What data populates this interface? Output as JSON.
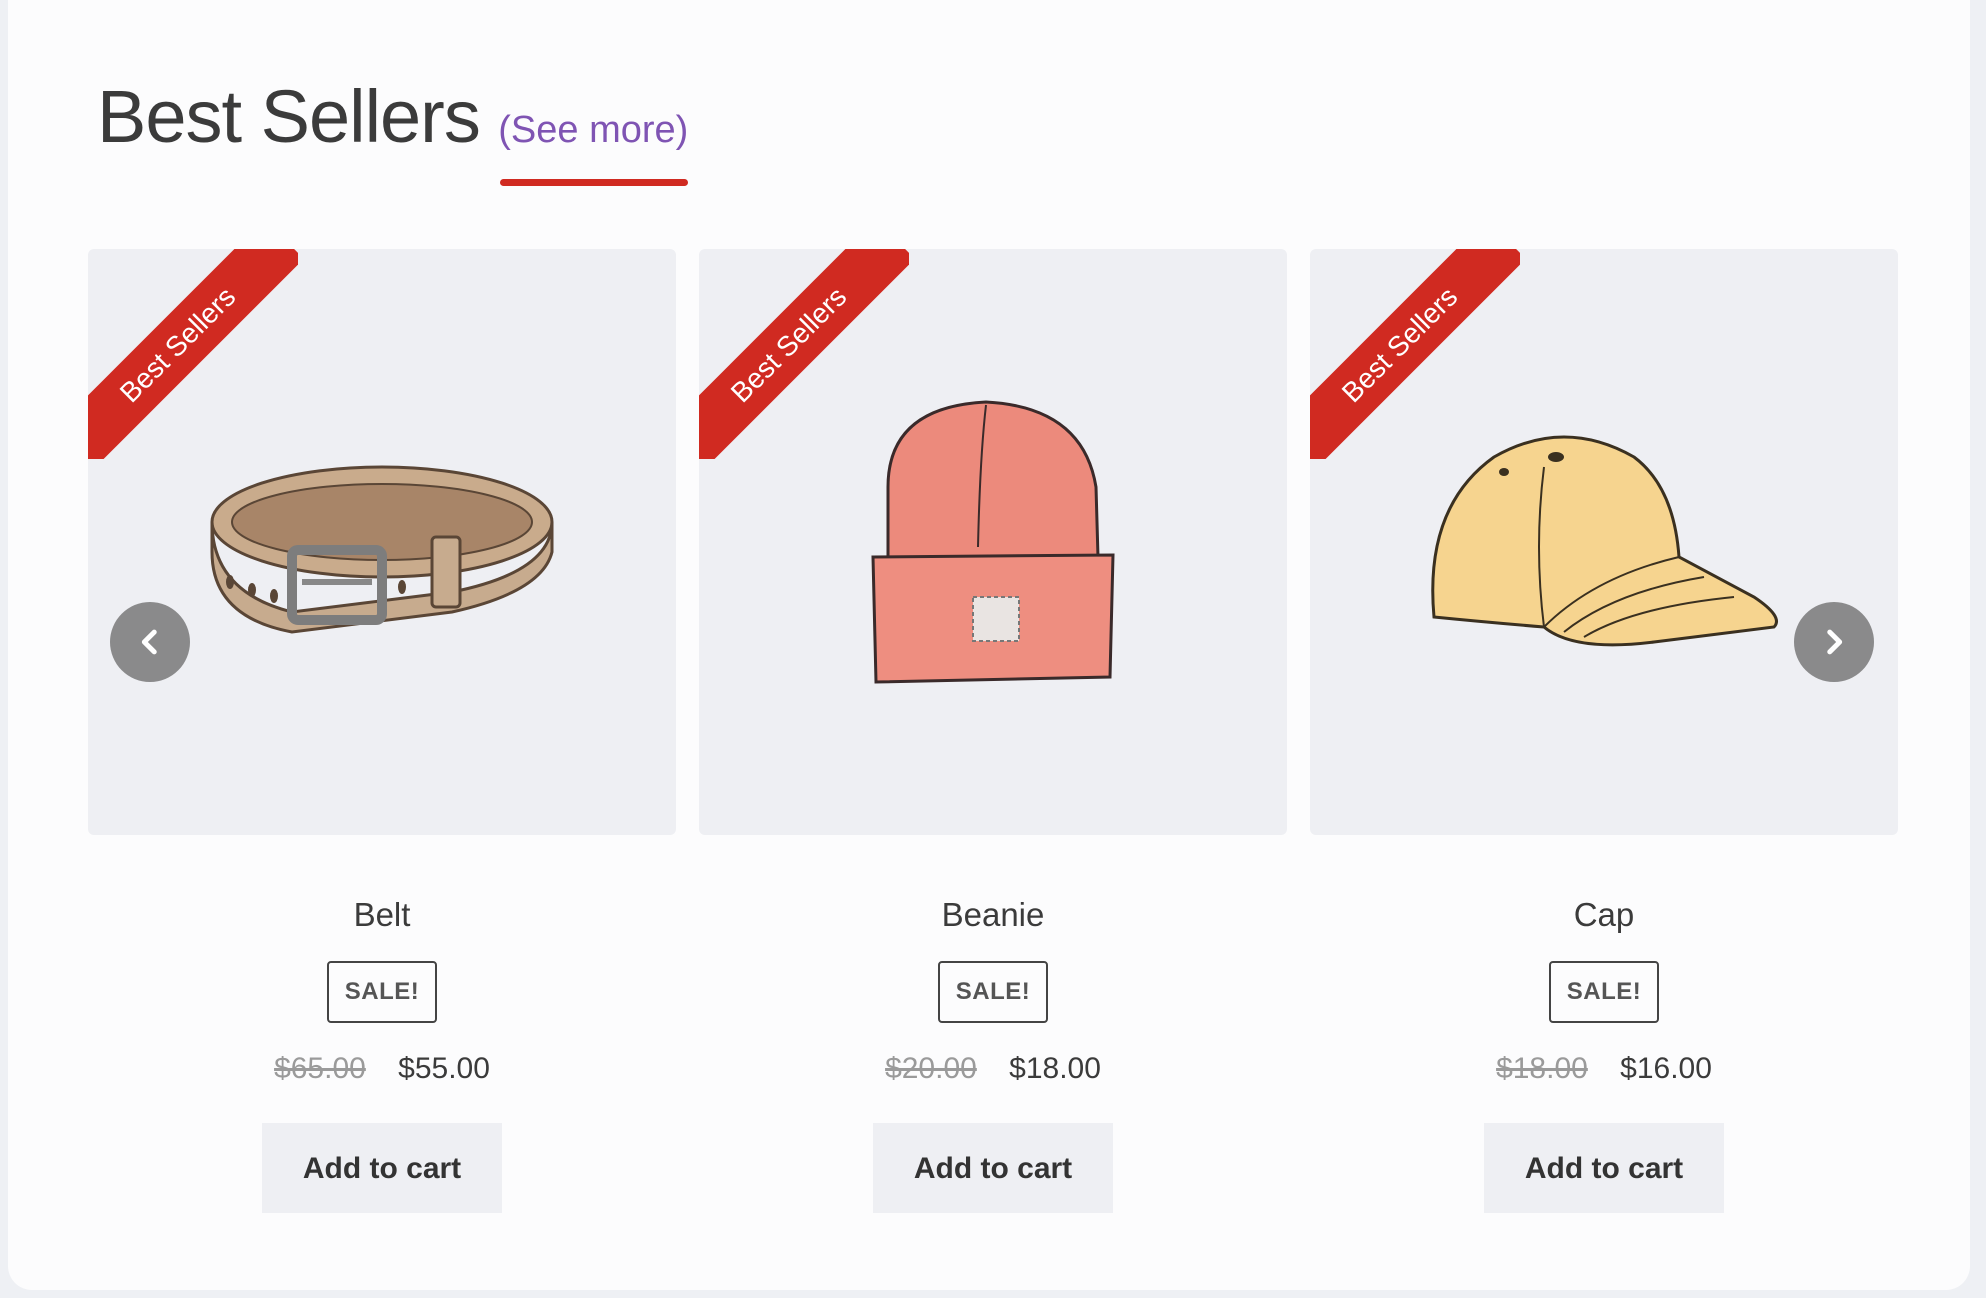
{
  "section": {
    "title": "Best Sellers",
    "see_more": "(See more)"
  },
  "products": [
    {
      "name": "Belt",
      "ribbon": "Best Sellers",
      "sale_badge": "SALE!",
      "old_price": "$65.00",
      "price": "$55.00",
      "button": "Add to cart",
      "image_icon": "belt-image"
    },
    {
      "name": "Beanie",
      "ribbon": "Best Sellers",
      "sale_badge": "SALE!",
      "old_price": "$20.00",
      "price": "$18.00",
      "button": "Add to cart",
      "image_icon": "beanie-image"
    },
    {
      "name": "Cap",
      "ribbon": "Best Sellers",
      "sale_badge": "SALE!",
      "old_price": "$18.00",
      "price": "$16.00",
      "button": "Add to cart",
      "image_icon": "cap-image"
    }
  ],
  "carousel": {
    "prev_icon": "chevron-left-icon",
    "next_icon": "chevron-right-icon"
  },
  "colors": {
    "accent_red": "#d02a21",
    "link_purple": "#7f54b3",
    "card_bg": "#eeeff3"
  }
}
